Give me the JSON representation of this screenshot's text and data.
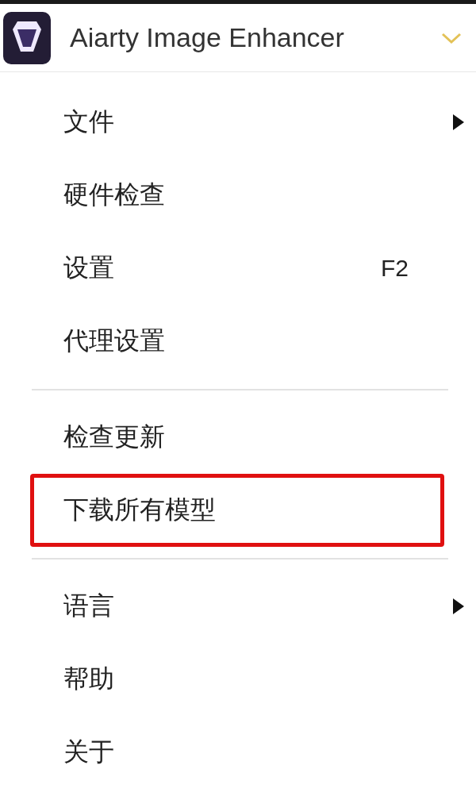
{
  "app": {
    "title": "Aiarty Image Enhancer"
  },
  "menu": [
    {
      "kind": "item",
      "label": "文件",
      "submenu": true,
      "highlighted": false
    },
    {
      "kind": "item",
      "label": "硬件检查",
      "submenu": false,
      "highlighted": false
    },
    {
      "kind": "item",
      "label": "设置",
      "shortcut": "F2",
      "submenu": false,
      "highlighted": false
    },
    {
      "kind": "item",
      "label": "代理设置",
      "submenu": false,
      "highlighted": false
    },
    {
      "kind": "separator"
    },
    {
      "kind": "item",
      "label": "检查更新",
      "submenu": false,
      "highlighted": false
    },
    {
      "kind": "item",
      "label": "下载所有模型",
      "submenu": false,
      "highlighted": true
    },
    {
      "kind": "separator"
    },
    {
      "kind": "item",
      "label": "语言",
      "submenu": true,
      "highlighted": false
    },
    {
      "kind": "item",
      "label": "帮助",
      "submenu": false,
      "highlighted": false
    },
    {
      "kind": "item",
      "label": "关于",
      "submenu": false,
      "highlighted": false
    }
  ]
}
